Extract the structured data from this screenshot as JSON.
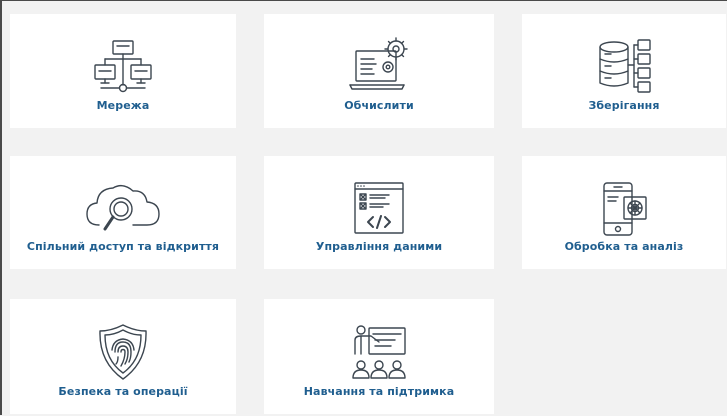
{
  "tiles": [
    {
      "label": "Мережа",
      "icon": "network-icon"
    },
    {
      "label": "Обчислити",
      "icon": "laptop-gear-icon"
    },
    {
      "label": "Зберігання",
      "icon": "database-storage-icon"
    },
    {
      "label": "Спільний доступ та відкриття",
      "icon": "cloud-search-icon"
    },
    {
      "label": "Управління даними",
      "icon": "code-window-icon"
    },
    {
      "label": "Обробка та аналіз",
      "icon": "mobile-chip-icon"
    },
    {
      "label": "Безпека та операції",
      "icon": "shield-fingerprint-icon"
    },
    {
      "label": "Навчання та підтримка",
      "icon": "presentation-training-icon"
    }
  ],
  "colors": {
    "label": "#1f5e8f",
    "icon": "#3c4650",
    "tile": "#ffffff",
    "background": "#f2f2f2"
  }
}
